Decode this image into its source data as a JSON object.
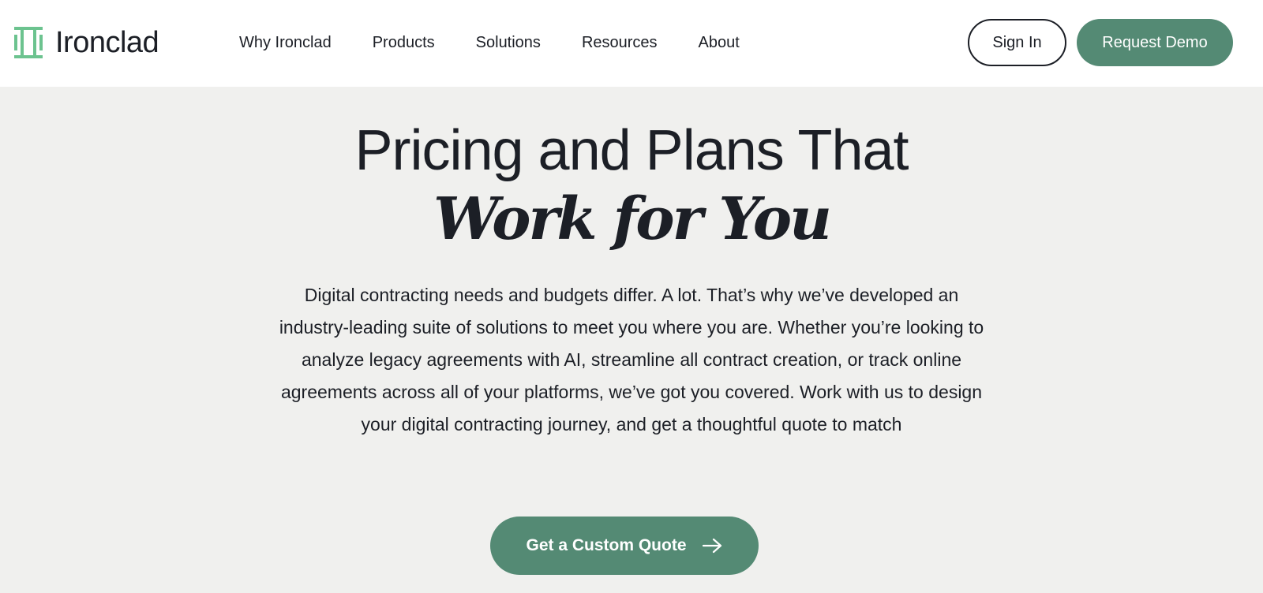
{
  "brand": {
    "name": "Ironclad",
    "logo_icon": "ironclad-logo-icon",
    "accent_color": "#548a74",
    "logo_color": "#6cc38f"
  },
  "nav": {
    "items": [
      {
        "label": "Why Ironclad"
      },
      {
        "label": "Products"
      },
      {
        "label": "Solutions"
      },
      {
        "label": "Resources"
      },
      {
        "label": "About"
      }
    ]
  },
  "header_actions": {
    "sign_in_label": "Sign In",
    "request_demo_label": "Request Demo"
  },
  "hero": {
    "title_line1": "Pricing and Plans That",
    "title_line2": "Work for You",
    "description": "Digital contracting needs and budgets differ. A lot. That’s why we’ve developed an industry-leading suite of solutions to meet you where you are. Whether you’re looking to analyze legacy agreements with AI, streamline all contract creation, or track online agreements across all of your platforms, we’ve got you covered. Work with us to design your digital contracting journey, and get a thoughtful quote to match",
    "cta_label": "Get a Custom Quote",
    "cta_icon": "arrow-right-icon"
  }
}
